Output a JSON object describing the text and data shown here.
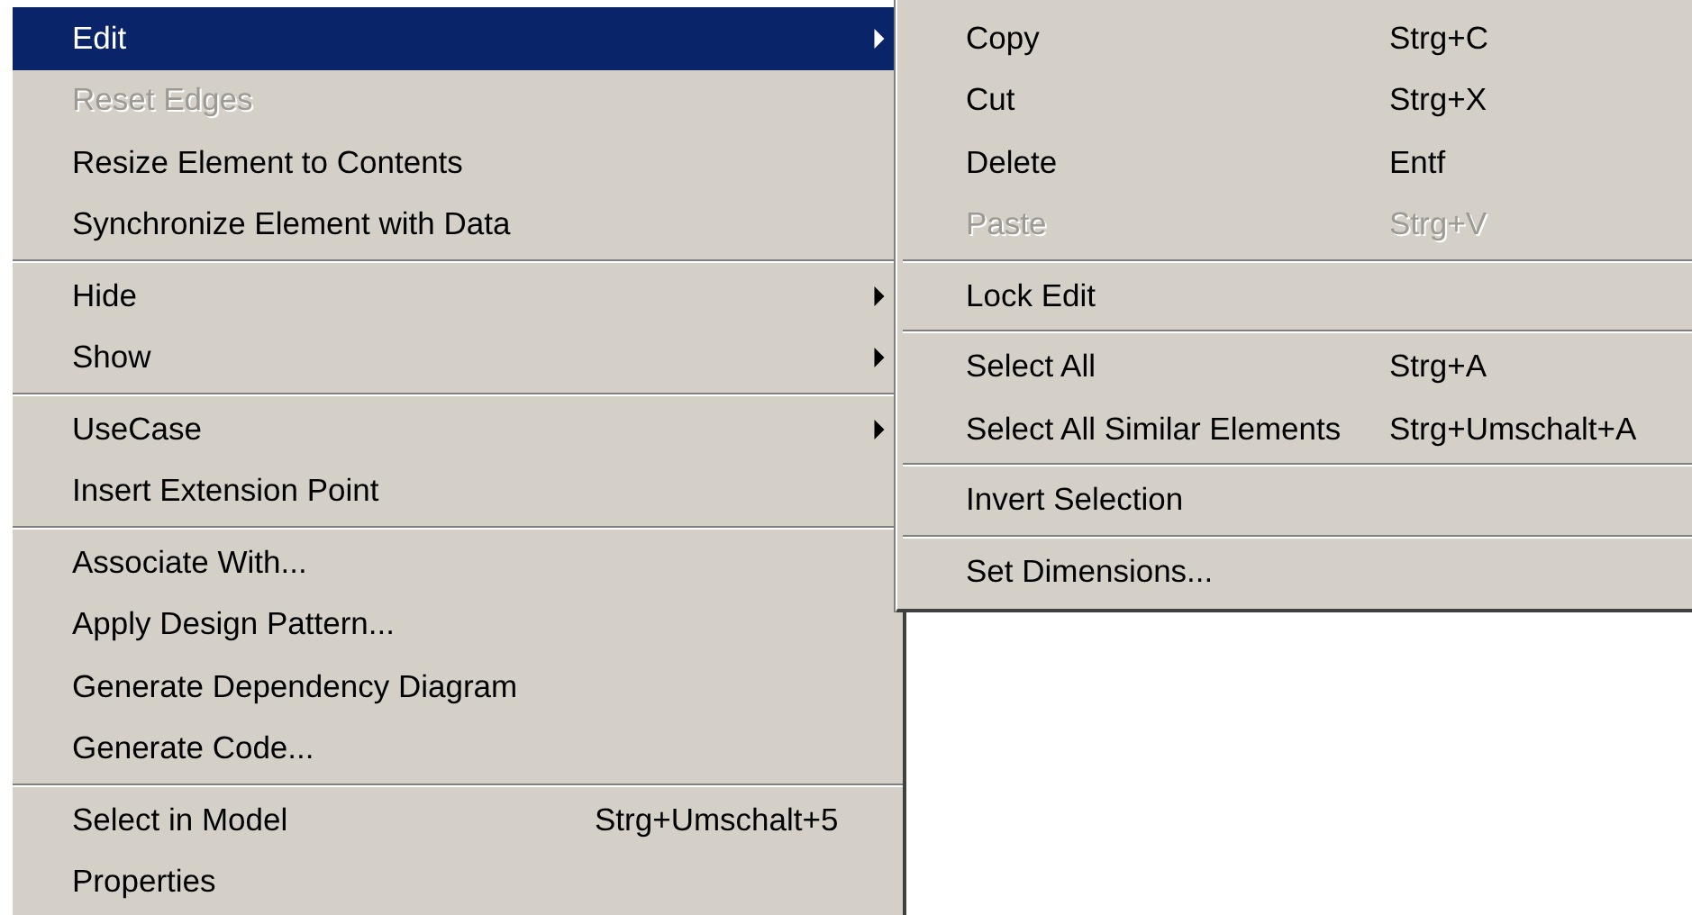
{
  "context_menu": {
    "groups": [
      {
        "items": [
          {
            "label": "Edit",
            "has_submenu": true,
            "selected": true,
            "disabled": false
          },
          {
            "label": "Reset Edges",
            "has_submenu": false,
            "selected": false,
            "disabled": true
          },
          {
            "label": "Resize Element to Contents",
            "has_submenu": false,
            "selected": false,
            "disabled": false
          },
          {
            "label": "Synchronize Element with Data",
            "has_submenu": false,
            "selected": false,
            "disabled": false
          }
        ]
      },
      {
        "items": [
          {
            "label": "Hide",
            "has_submenu": true,
            "selected": false,
            "disabled": false
          },
          {
            "label": "Show",
            "has_submenu": true,
            "selected": false,
            "disabled": false
          }
        ]
      },
      {
        "items": [
          {
            "label": "UseCase",
            "has_submenu": true,
            "selected": false,
            "disabled": false
          },
          {
            "label": "Insert Extension Point",
            "has_submenu": false,
            "selected": false,
            "disabled": false
          }
        ]
      },
      {
        "items": [
          {
            "label": "Associate With...",
            "has_submenu": false,
            "selected": false,
            "disabled": false
          },
          {
            "label": "Apply Design Pattern...",
            "has_submenu": false,
            "selected": false,
            "disabled": false
          },
          {
            "label": "Generate Dependency Diagram",
            "has_submenu": false,
            "selected": false,
            "disabled": false
          },
          {
            "label": "Generate Code...",
            "has_submenu": false,
            "selected": false,
            "disabled": false
          }
        ]
      },
      {
        "items": [
          {
            "label": "Select in Model",
            "shortcut": "Strg+Umschalt+5",
            "has_submenu": false,
            "selected": false,
            "disabled": false
          },
          {
            "label": "Properties",
            "has_submenu": false,
            "selected": false,
            "disabled": false
          }
        ]
      }
    ]
  },
  "edit_submenu": {
    "groups": [
      {
        "items": [
          {
            "label": "Copy",
            "shortcut": "Strg+C",
            "disabled": false
          },
          {
            "label": "Cut",
            "shortcut": "Strg+X",
            "disabled": false
          },
          {
            "label": "Delete",
            "shortcut": "Entf",
            "disabled": false
          },
          {
            "label": "Paste",
            "shortcut": "Strg+V",
            "disabled": true
          }
        ]
      },
      {
        "items": [
          {
            "label": "Lock Edit",
            "disabled": false
          }
        ]
      },
      {
        "items": [
          {
            "label": "Select All",
            "shortcut": "Strg+A",
            "disabled": false
          },
          {
            "label": "Select All Similar Elements",
            "shortcut": "Strg+Umschalt+A",
            "disabled": false
          }
        ]
      },
      {
        "items": [
          {
            "label": "Invert Selection",
            "disabled": false
          }
        ]
      },
      {
        "items": [
          {
            "label": "Set Dimensions...",
            "disabled": false
          }
        ]
      }
    ]
  }
}
